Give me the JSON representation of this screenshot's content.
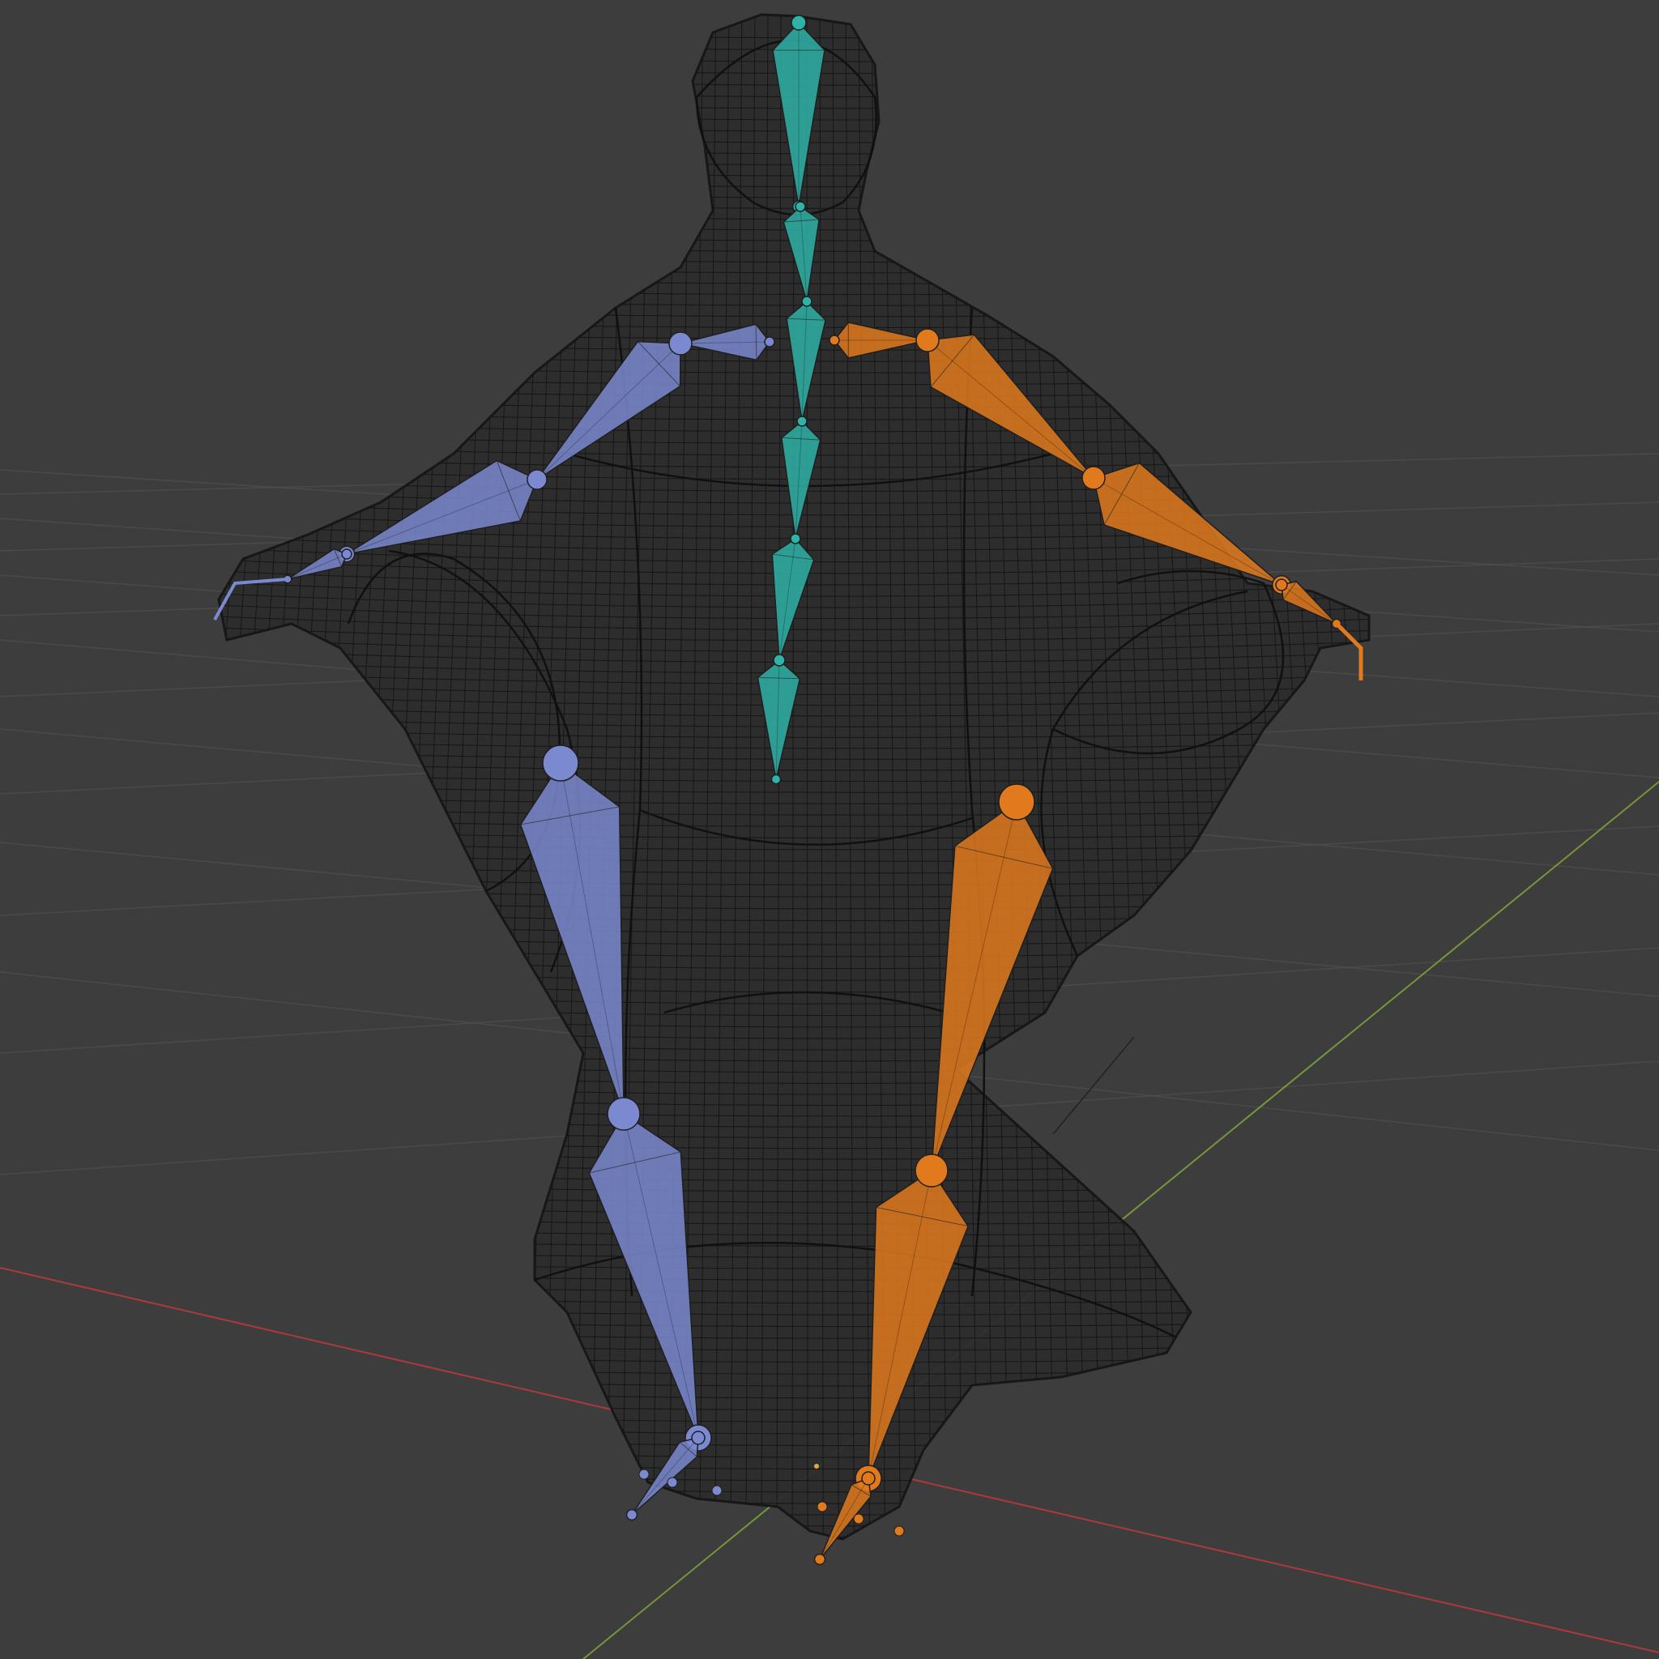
{
  "viewport": {
    "mode": "3D viewport",
    "shading": "wireframe",
    "background_color": "#3d3d3d",
    "grid_color": "#505050",
    "axis_x_color": "#c0393b",
    "axis_y_color": "#7fa63a"
  },
  "armature": {
    "center_color": "#2fb3a8",
    "left_color": "#7b8ad0",
    "right_color": "#e07a1d",
    "bones": [
      "head",
      "neck",
      "spine-upper",
      "spine-mid",
      "spine-lower",
      "pelvis",
      "shoulder-l",
      "upper-arm-l",
      "forearm-l",
      "hand-l",
      "shoulder-r",
      "upper-arm-r",
      "forearm-r",
      "hand-r",
      "thigh-l",
      "shin-l",
      "foot-l",
      "thigh-r",
      "shin-r",
      "foot-r"
    ]
  },
  "mesh": {
    "name": "character-mesh",
    "wire_color": "#151515"
  }
}
